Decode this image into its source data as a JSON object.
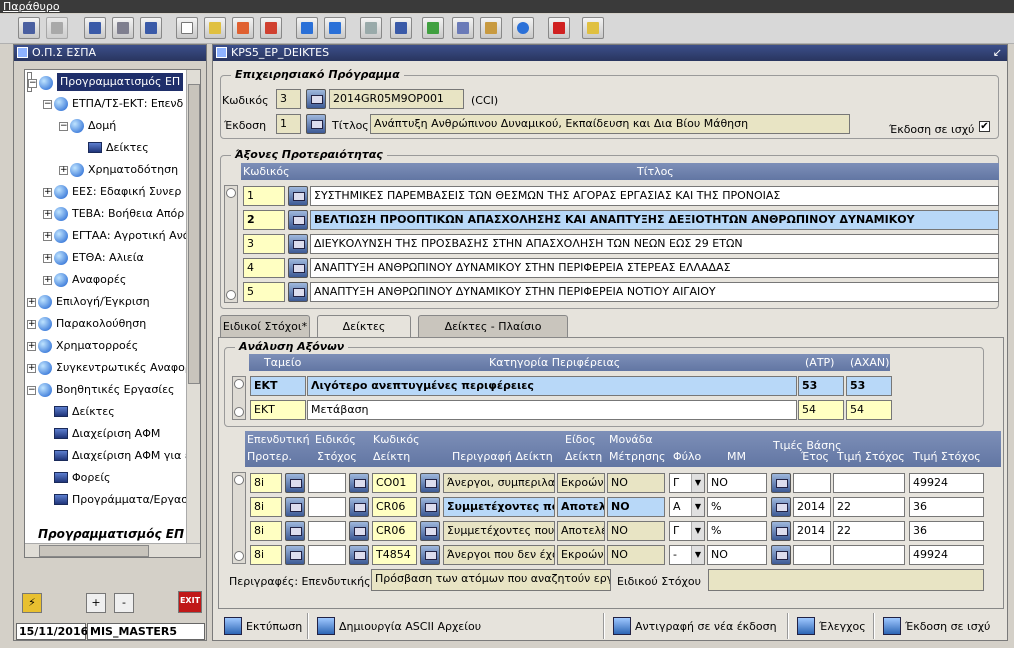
{
  "menu": {
    "label": "Παράθυρο"
  },
  "left_panel": {
    "title": "Ο.Π.Σ ΕΣΠΑ",
    "tree": [
      {
        "label": "Προγραμματισμός ΕΠ",
        "icon": "globe",
        "expander": "minus",
        "selected": true
      },
      {
        "label": "ΕΤΠΑ/ΤΣ-ΕΚΤ: Επενδ",
        "icon": "globe",
        "expander": "minus"
      },
      {
        "label": "Δομή",
        "icon": "globe",
        "expander": "minus"
      },
      {
        "label": "Δείκτες",
        "icon": "book"
      },
      {
        "label": "Χρηματοδότηση",
        "icon": "globe",
        "expander": "plus"
      },
      {
        "label": "ΕΕΣ: Εδαφική Συνερ",
        "icon": "globe",
        "expander": "plus"
      },
      {
        "label": "ΤΕΒΑ: Βοήθεια Απόρ",
        "icon": "globe",
        "expander": "plus"
      },
      {
        "label": "ΕΓΤΑΑ: Αγροτική Ανά",
        "icon": "globe",
        "expander": "plus"
      },
      {
        "label": "ΕΤΘΑ: Αλιεία",
        "icon": "globe",
        "expander": "plus"
      },
      {
        "label": "Αναφορές",
        "icon": "globe",
        "expander": "plus"
      },
      {
        "label": "Επιλογή/Έγκριση",
        "icon": "globe",
        "expander": "plus"
      },
      {
        "label": "Παρακολούθηση",
        "icon": "globe",
        "expander": "plus"
      },
      {
        "label": "Χρηματορροές",
        "icon": "globe",
        "expander": "plus"
      },
      {
        "label": "Συγκεντρωτικές Αναφορ",
        "icon": "globe",
        "expander": "plus"
      },
      {
        "label": "Βοηθητικές Εργασίες",
        "icon": "globe",
        "expander": "minus"
      },
      {
        "label": "Δείκτες",
        "icon": "book"
      },
      {
        "label": "Διαχείριση ΑΦΜ",
        "icon": "book"
      },
      {
        "label": "Διαχείριση ΑΦΜ για ε",
        "icon": "book"
      },
      {
        "label": "Φορείς",
        "icon": "book"
      },
      {
        "label": "Προγράμματα/Εργασ",
        "icon": "book"
      }
    ],
    "caption": "Προγραμματισμός ΕΠ",
    "plus_label": "+",
    "minus_label": "-",
    "exit_label": "EXIT",
    "date": "15/11/2016",
    "user": "MIS_MASTER5"
  },
  "main": {
    "title": "KPS5_EP_DEIKTES",
    "op": {
      "group_title": "Επιχειρησιακό Πρόγραμμα",
      "code_label": "Κωδικός",
      "code_value": "3",
      "cci_value": "2014GR05M9OP001",
      "cci_label": "(CCI)",
      "version_label": "Έκδοση",
      "version_value": "1",
      "title_label": "Τίτλος",
      "title_value": "Ανάπτυξη Ανθρώπινου Δυναμικού, Εκπαίδευση και Δια Βίου Μάθηση",
      "valid_label": "Έκδοση σε ισχύ",
      "valid_checked": "✔"
    },
    "axes": {
      "group_title": "Άξονες Προτεραιότητας",
      "headers": {
        "code": "Κωδικός",
        "title": "Τίτλος"
      },
      "rows": [
        {
          "code": "1",
          "title": "ΣΥΣΤΗΜΙΚΕΣ ΠΑΡΕΜΒΑΣΕΙΣ ΤΩΝ ΘΕΣΜΩΝ ΤΗΣ ΑΓΟΡΑΣ ΕΡΓΑΣΙΑΣ ΚΑΙ ΤΗΣ ΠΡΟΝΟΙΑΣ",
          "selected": false
        },
        {
          "code": "2",
          "title": "ΒΕΛΤΙΩΣΗ ΠΡΟΟΠΤΙΚΩΝ ΑΠΑΣΧΟΛΗΣΗΣ ΚΑΙ ΑΝΑΠΤΥΞΗΣ ΔΕΞΙΟΤΗΤΩΝ ΑΝΘΡΩΠΙΝΟΥ ΔΥΝΑΜΙΚΟΥ",
          "selected": true
        },
        {
          "code": "3",
          "title": "ΔΙΕΥΚΟΛΥΝΣΗ ΤΗΣ ΠΡΟΣΒΑΣΗΣ ΣΤΗΝ ΑΠΑΣΧΟΛΗΣΗ ΤΩΝ ΝΕΩΝ ΕΩΣ 29 ΕΤΩΝ",
          "selected": false
        },
        {
          "code": "4",
          "title": "ΑΝΑΠΤΥΞΗ ΑΝΘΡΩΠΙΝΟΥ ΔΥΝΑΜΙΚΟΥ ΣΤΗΝ ΠΕΡΙΦΕΡΕΙΑ ΣΤΕΡΕΑΣ ΕΛΛΑΔΑΣ",
          "selected": false
        },
        {
          "code": "5",
          "title": "ΑΝΑΠΤΥΞΗ ΑΝΘΡΩΠΙΝΟΥ ΔΥΝΑΜΙΚΟΥ ΣΤΗΝ ΠΕΡΙΦΕΡΕΙΑ ΝΟΤΙΟΥ ΑΙΓΑΙΟΥ",
          "selected": false
        }
      ]
    },
    "tabs": [
      {
        "label": "Ειδικοί Στόχοι*",
        "active": false
      },
      {
        "label": "Δείκτες",
        "active": true
      },
      {
        "label": "Δείκτες - Πλαίσιο Επίδοσης",
        "active": false
      }
    ],
    "analysis": {
      "group_title": "Ανάλυση Αξόνων",
      "headers": {
        "fund": "Ταμείο",
        "category": "Κατηγορία Περιφέρειας",
        "atp": "(ΑΤΡ)",
        "axan": "(ΑΧΑΝ)"
      },
      "rows": [
        {
          "fund": "ΕΚΤ",
          "category": "Λιγότερο ανεπτυγμένες περιφέρειες",
          "atp": "53",
          "axan": "53",
          "selected": true
        },
        {
          "fund": "ΕΚΤ",
          "category": "Μετάβαση",
          "atp": "54",
          "axan": "54",
          "selected": false
        }
      ]
    },
    "indicators": {
      "headers": {
        "inv1": "Επενδυτική",
        "inv2": "Προτερ.",
        "spec1": "Ειδικός",
        "spec2": "Στόχος",
        "code1": "Κωδικός",
        "code2": "Δείκτη",
        "desc": "Περιγραφή Δείκτη",
        "type1": "Είδος",
        "type2": "Δείκτη",
        "unit1": "Μονάδα",
        "unit2": "Μέτρησης",
        "sex": "Φύλο",
        "base_group": "Τιμές Βάσης",
        "mm": "ΜΜ",
        "year": "Έτος",
        "base_target": "Τιμή Στόχος",
        "target": "Τιμή Στόχος"
      },
      "rows": [
        {
          "inv": "8i",
          "spec": "",
          "code": "CO01",
          "desc": "Άνεργοι, συμπεριλαμ",
          "type": "Εκροών",
          "unit": "ΝΟ",
          "sex": "Γ",
          "mm": "ΝΟ",
          "year": "",
          "base": "",
          "target": "49924",
          "selected": false
        },
        {
          "inv": "8i",
          "spec": "",
          "code": "CR06",
          "desc": "Συμμετέχοντες που",
          "type": "Αποτελ",
          "unit": "ΝΟ",
          "sex": "Α",
          "mm": "%",
          "year": "2014",
          "base": "22",
          "target": "36",
          "selected": true
        },
        {
          "inv": "8i",
          "spec": "",
          "code": "CR06",
          "desc": "Συμμετέχοντες που κ",
          "type": "Αποτελέ",
          "unit": "ΝΟ",
          "sex": "Γ",
          "mm": "%",
          "year": "2014",
          "base": "22",
          "target": "36",
          "selected": false
        },
        {
          "inv": "8i",
          "spec": "",
          "code": "T4854",
          "desc": "Άνεργοι που δεν έχου",
          "type": "Εκροών",
          "unit": "ΝΟ",
          "sex": "-",
          "mm": "ΝΟ",
          "year": "",
          "base": "",
          "target": "49924",
          "selected": false
        }
      ],
      "desc_label": "Περιγραφές: Επενδυτικής",
      "desc_value": "Πρόσβαση των ατόμων που αναζητούν εργα",
      "spec_label": "Ειδικού Στόχου",
      "spec_value": ""
    },
    "bottom": {
      "print": "Εκτύπωση",
      "ascii": "Δημιουργία ASCII Αρχείου",
      "copy": "Αντιγραφή σε νέα έκδοση",
      "check": "Έλεγχος",
      "publish": "Έκδοση σε ισχύ"
    }
  }
}
